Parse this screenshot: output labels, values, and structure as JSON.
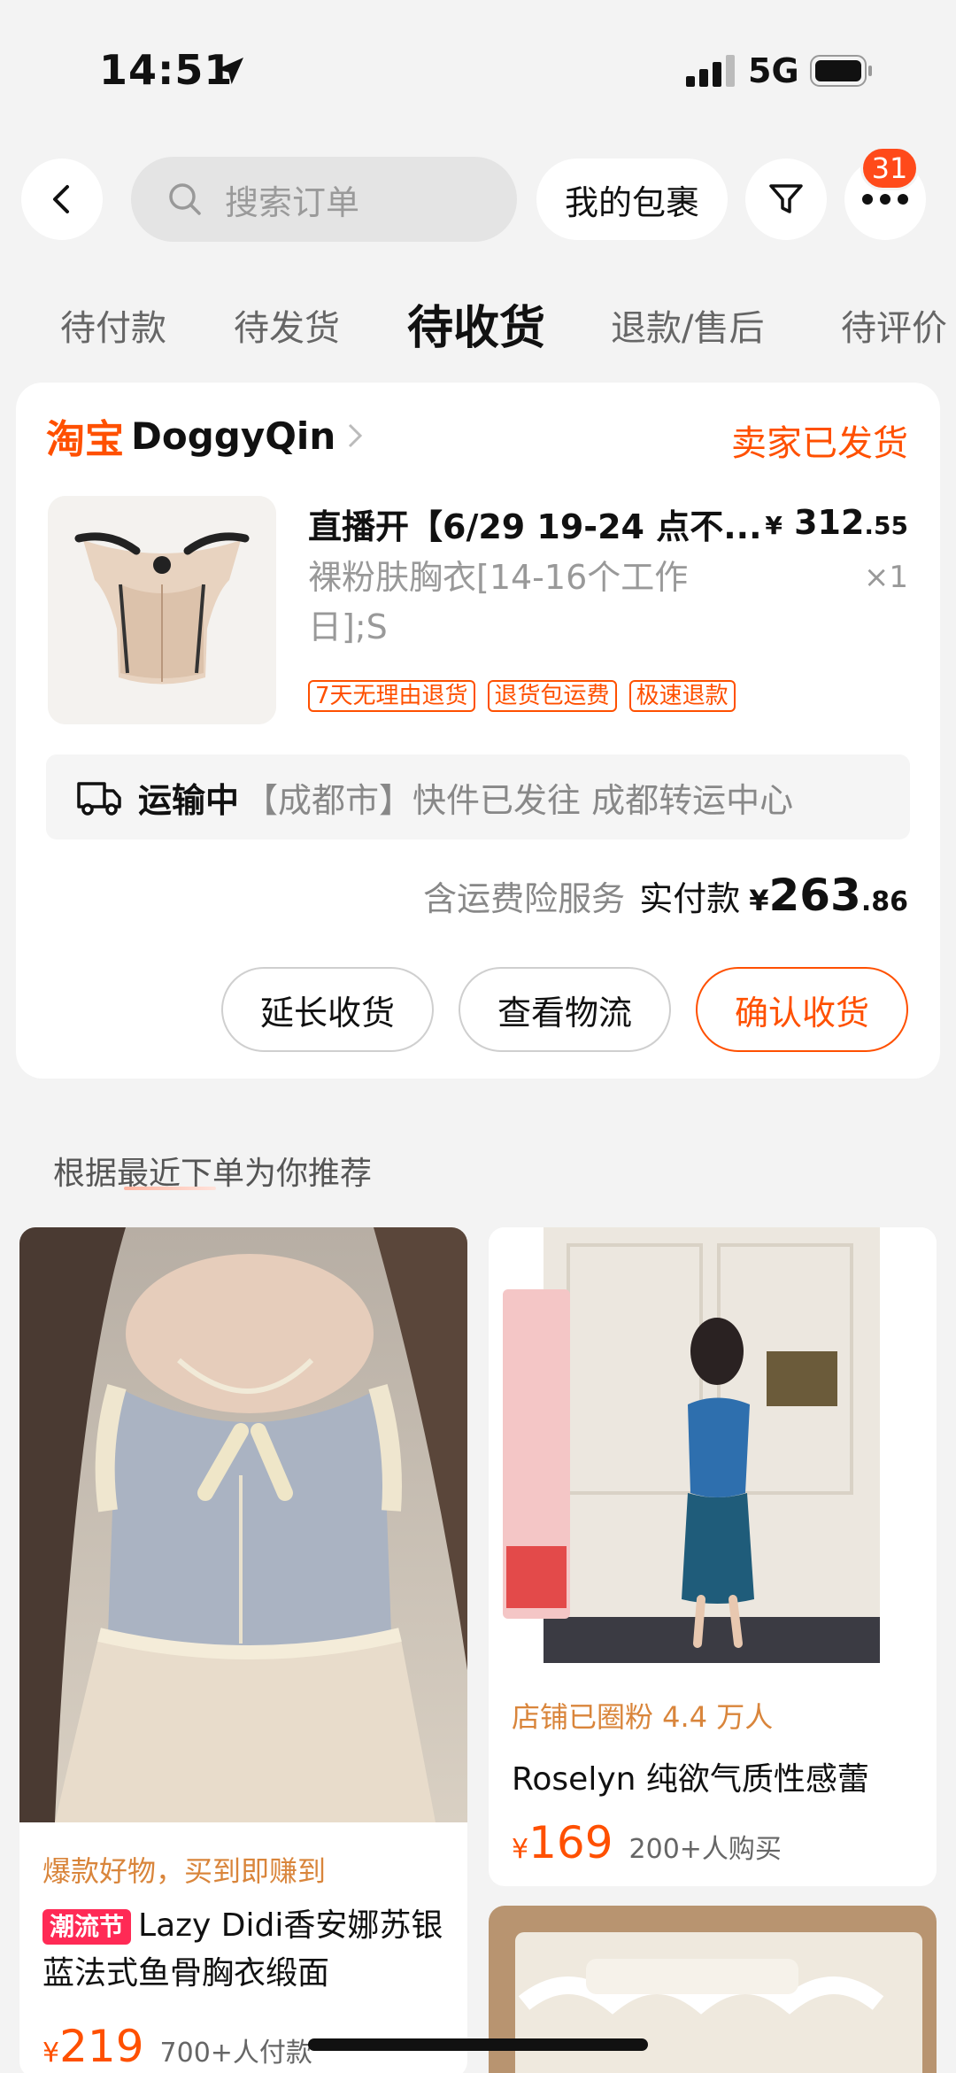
{
  "status_bar": {
    "time": "14:51",
    "network": "5G"
  },
  "nav": {
    "search_placeholder": "搜索订单",
    "my_packages": "我的包裹",
    "badge_count": "31"
  },
  "tabs": [
    {
      "label": "待付款",
      "active": false
    },
    {
      "label": "待发货",
      "active": false
    },
    {
      "label": "待收货",
      "active": true
    },
    {
      "label": "退款/售后",
      "active": false
    },
    {
      "label": "待评价",
      "active": false
    }
  ],
  "order": {
    "platform": "淘宝",
    "shop_name": "DoggyQin",
    "status": "卖家已发货",
    "product_title": "直播开【6/29 19-24 点不...",
    "price_yen": "¥",
    "price_int": "312",
    "price_cents": ".55",
    "spec": "裸粉肤胸衣[14-16个工作日];S",
    "qty": "×1",
    "tags": [
      "7天无理由退货",
      "退货包运费",
      "极速退款"
    ],
    "shipping_status": "运输中",
    "shipping_detail": "【成都市】快件已发往 成都转运中心",
    "insurance": "含运费险服务",
    "paid_label": "实付款",
    "paid_yen": "¥",
    "paid_int": "263",
    "paid_cents": ".86",
    "buttons": {
      "extend": "延长收货",
      "logistics": "查看物流",
      "confirm": "确认收货"
    }
  },
  "recommend": {
    "title": "根据最近下单为你推荐",
    "left": {
      "promo": "爆款好物，买到即赚到",
      "tag": "潮流节",
      "title": "Lazy Didi香安娜苏银蓝法式鱼骨胸衣缎面",
      "yen": "¥",
      "price": "219",
      "sold": "700+人付款"
    },
    "right": {
      "promo": "店铺已圈粉 4.4 万人",
      "title": "Roselyn 纯欲气质性感蕾",
      "yen": "¥",
      "price": "169",
      "sold": "200+人购买"
    }
  },
  "colors": {
    "accent": "#ff5000",
    "badge": "#ff4a1a",
    "promo": "#d9853b"
  }
}
